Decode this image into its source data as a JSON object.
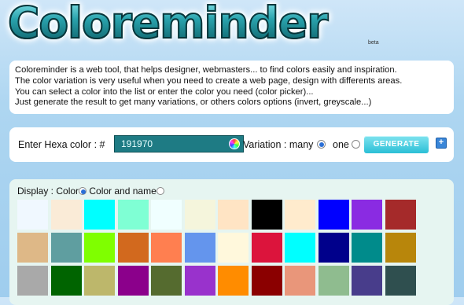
{
  "header": {
    "logo_text": "Coloreminder",
    "beta": "beta"
  },
  "description": {
    "lines": [
      "Coloreminder is a web tool, that helps designer, webmasters... to find colors easily and inspiration.",
      "The color variation is very useful when you need to create a web page, design with differents areas.",
      "You can select a color into the list or enter the color you need (color picker)...",
      "Just generate the result to get many variations, or others colors options (invert, greyscale...)"
    ]
  },
  "form": {
    "hex_label": "Enter Hexa color :  #",
    "hex_value": "191970",
    "variation_label": "Variation : many",
    "one_label": "one",
    "generate_label": "GENERATE",
    "plus_label": "+"
  },
  "display": {
    "label": "Display : Color",
    "name_label": "Color and name"
  },
  "swatches": [
    [
      "#f0f8ff",
      "#faebd7",
      "#00ffff",
      "#7fffd4",
      "#f0ffff",
      "#f5f5dc",
      "#ffe4c4",
      "#000000",
      "#ffebcd",
      "#0000ff",
      "#8a2be2",
      "#a52a2a"
    ],
    [
      "#deb887",
      "#5f9ea0",
      "#7fff00",
      "#d2691e",
      "#ff7f50",
      "#6495ed",
      "#fff8dc",
      "#dc143c",
      "#00ffff",
      "#00008b",
      "#008b8b",
      "#b8860b"
    ],
    [
      "#a9a9a9",
      "#006400",
      "#bdb76b",
      "#8b008b",
      "#556b2f",
      "#9932cc",
      "#ff8c00",
      "#8b0000",
      "#e9967a",
      "#8fbc8f",
      "#483d8b",
      "#2f4f4f"
    ]
  ]
}
